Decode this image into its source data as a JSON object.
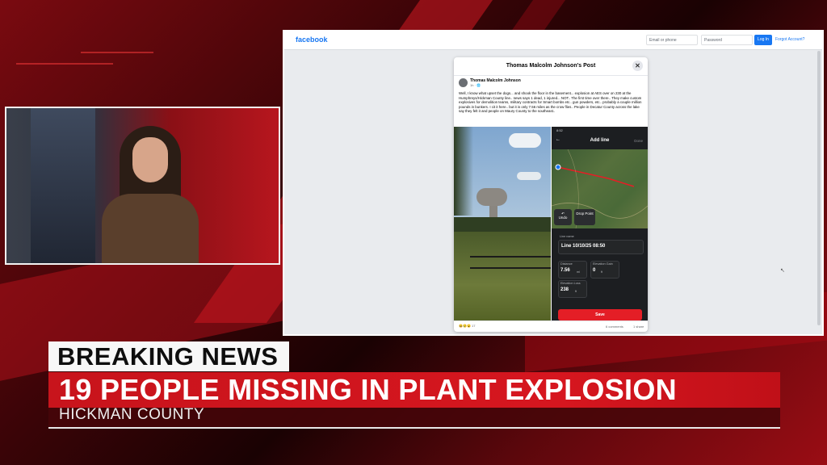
{
  "browser": {
    "logo": "facebook",
    "email_placeholder": "Email or phone",
    "password_placeholder": "Password",
    "login_label": "Log In",
    "forgot_label": "Forgot Account?"
  },
  "post": {
    "header_title": "Thomas Malcolm Johnson's Post",
    "close_glyph": "✕",
    "author": "Thomas Malcolm Johnson",
    "meta": "1h · 🌐",
    "text": "Well, I know what upset the dogs... and shook the floor in the basement... explosion at AES over on 230 at the Humphreys/Hickman County line.. news says 1 dead, 1 injured... NOT.. The first time over there.. They make custom explosives for demolition teams, military contracts for Smart bombs etc.. gun powders, etc.. probably a couple million pounds in bunkers. I cit it here.. but it is only 7.56 miles as the crow flies.. People in Decatur County across the lake say they felt it and people on Maury County to the southeast..",
    "reactions": "😆😢😮 17",
    "comments": "6 comments",
    "shares": "1 share"
  },
  "phone": {
    "status_time": "8:52",
    "back_glyph": "←",
    "title": "Add line",
    "done_label": "Done",
    "undo_label": "Undo",
    "drop_label": "Drop Point",
    "line_name_label": "Line name",
    "line_name": "Line 10/10/25 08:50",
    "distance_label": "Distance",
    "distance_value": "7.56",
    "distance_unit": "mi",
    "elev_gain_label": "Elevation Gain",
    "elev_gain_value": "0",
    "elev_gain_unit": "ft",
    "elev_loss_label": "Elevation Loss",
    "elev_loss_value": "238",
    "elev_loss_unit": "ft",
    "save_label": "Save"
  },
  "lower_third": {
    "tag": "BREAKING NEWS",
    "headline": "19 PEOPLE MISSING IN PLANT EXPLOSION",
    "subline": "HICKMAN COUNTY"
  },
  "colors": {
    "facebook_blue": "#1877f2",
    "breaking_red": "#d6161f",
    "route_red": "#e41e26"
  }
}
